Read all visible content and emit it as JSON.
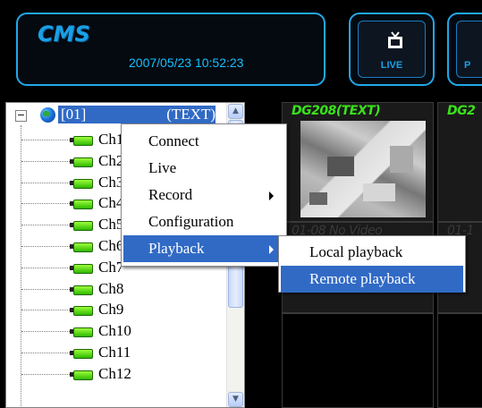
{
  "header": {
    "app_title": "CMS",
    "datetime": "2007/05/23 10:52:23",
    "live_label": "LIVE",
    "playback_label_partial": "P"
  },
  "tree": {
    "root_id": "[01]",
    "root_tag": "(TEXT)",
    "channels": [
      "Ch1",
      "Ch2",
      "Ch3",
      "Ch4",
      "Ch5",
      "Ch6",
      "Ch7",
      "Ch8",
      "Ch9",
      "Ch10",
      "Ch11",
      "Ch12"
    ]
  },
  "video_grid": {
    "cells": [
      {
        "label": "DG208(TEXT)"
      },
      {
        "label": "DG2"
      },
      {
        "label": "01-08 No Video"
      },
      {
        "label": "01-1"
      }
    ]
  },
  "context_menu": {
    "items": [
      "Connect",
      "Live",
      "Record",
      "Configuration",
      "Playback"
    ],
    "selected": "Playback"
  },
  "submenu": {
    "items": [
      "Local playback",
      "Remote playback"
    ],
    "selected": "Remote playback"
  },
  "colors": {
    "accent": "#20a8e8",
    "selection": "#316ac5",
    "video_label": "#39e31a"
  },
  "icons": {
    "live": "tv-icon",
    "root": "globe-icon",
    "channel": "camera-icon"
  }
}
